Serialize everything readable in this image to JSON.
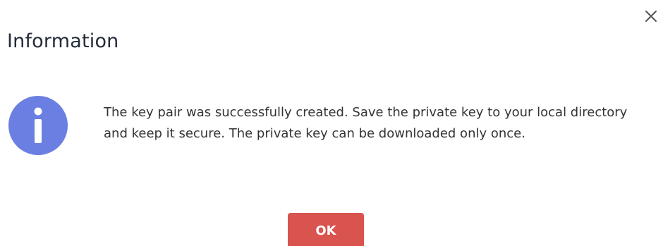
{
  "dialog": {
    "title": "Information",
    "close_icon": "close-icon",
    "info_icon": "info-icon",
    "message": "The key pair was successfully created. Save the private key to your local directory and keep it secure. The private key can be downloaded only once.",
    "ok_label": "OK"
  },
  "colors": {
    "info_icon": "#6b7fe3",
    "ok_button": "#d9534f",
    "title_text": "#252b3a",
    "body_text": "#333333",
    "close_icon": "#555555"
  }
}
